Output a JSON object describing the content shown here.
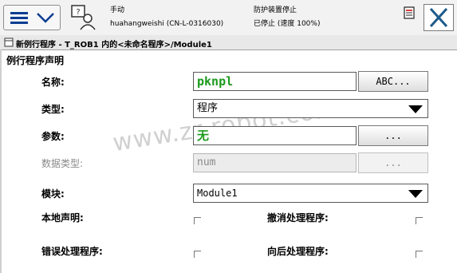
{
  "status": {
    "mode": "手动",
    "controller": "huahangweishi (CN-L-0316030)",
    "safety": "防护装置停止",
    "state": "已停止 (速度 100%)"
  },
  "title": "新例行程序 - T_ROB1 内的<未命名程序>/Module1",
  "section_header": "例行程序声明",
  "form": {
    "name": {
      "label": "名称:",
      "value": "pknpl",
      "button": "ABC..."
    },
    "type": {
      "label": "类型:",
      "value": "程序"
    },
    "params": {
      "label": "参数:",
      "value": "无",
      "button": "..."
    },
    "datatype": {
      "label": "数据类型:",
      "value": "num",
      "button": "..."
    },
    "module": {
      "label": "模块:",
      "value": "Module1"
    },
    "local": {
      "label": "本地声明:"
    },
    "undo": {
      "label": "撤消处理程序:"
    },
    "error": {
      "label": "错误处理程序:"
    },
    "backward": {
      "label": "向后处理程序:"
    }
  },
  "watermark": "www.zr-robot.com",
  "colors": {
    "accent": "#0b3d91",
    "value_green": "#1c9a1c"
  },
  "icons": [
    "menu-icon",
    "chevron-down-icon",
    "operator-icon",
    "state-icon",
    "close-icon",
    "window-icon"
  ]
}
